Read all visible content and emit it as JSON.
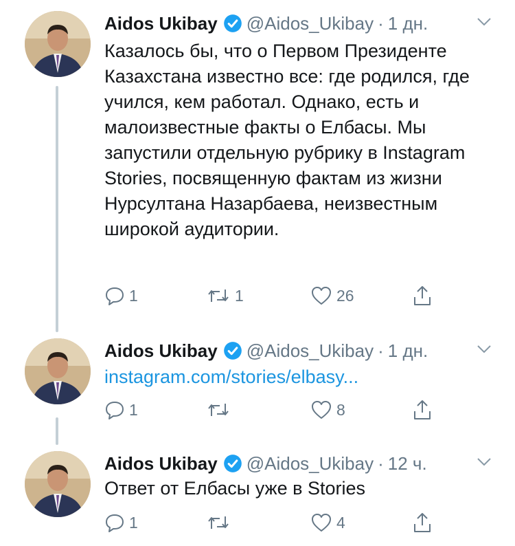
{
  "author": {
    "name": "Aidos Ukibay",
    "handle": "@Aidos_Ukibay"
  },
  "colors": {
    "link": "#1b95e0",
    "secondary_text": "#657786",
    "verified": "#1da1f2",
    "thread_line": "#c4cfd6"
  },
  "icons": [
    "verified-badge-icon",
    "chevron-down-icon",
    "reply-icon",
    "retweet-icon",
    "heart-icon",
    "share-icon"
  ],
  "tweets": [
    {
      "name": "Aidos Ukibay",
      "handle": "@Aidos_Ukibay",
      "separator": "·",
      "time": "1 дн.",
      "text": "Казалось бы, что о Первом Президенте Казахстана известно все: где родился, где учился, кем работал. Однако, есть и малоизвестные факты о Елбасы. Мы запустили отдельную рубрику в Instagram Stories, посвященную фактам из жизни Нурсултана Назарбаева, неизвестным широкой аудитории.",
      "replies": "1",
      "retweets": "1",
      "likes": "26"
    },
    {
      "name": "Aidos Ukibay",
      "handle": "@Aidos_Ukibay",
      "separator": "·",
      "time": "1 дн.",
      "link": "instagram.com/stories/elbasy...",
      "replies": "1",
      "retweets": "",
      "likes": "8"
    },
    {
      "name": "Aidos Ukibay",
      "handle": "@Aidos_Ukibay",
      "separator": "·",
      "time": "12 ч.",
      "text": "Ответ от Елбасы уже в Stories",
      "replies": "1",
      "retweets": "",
      "likes": "4"
    }
  ]
}
